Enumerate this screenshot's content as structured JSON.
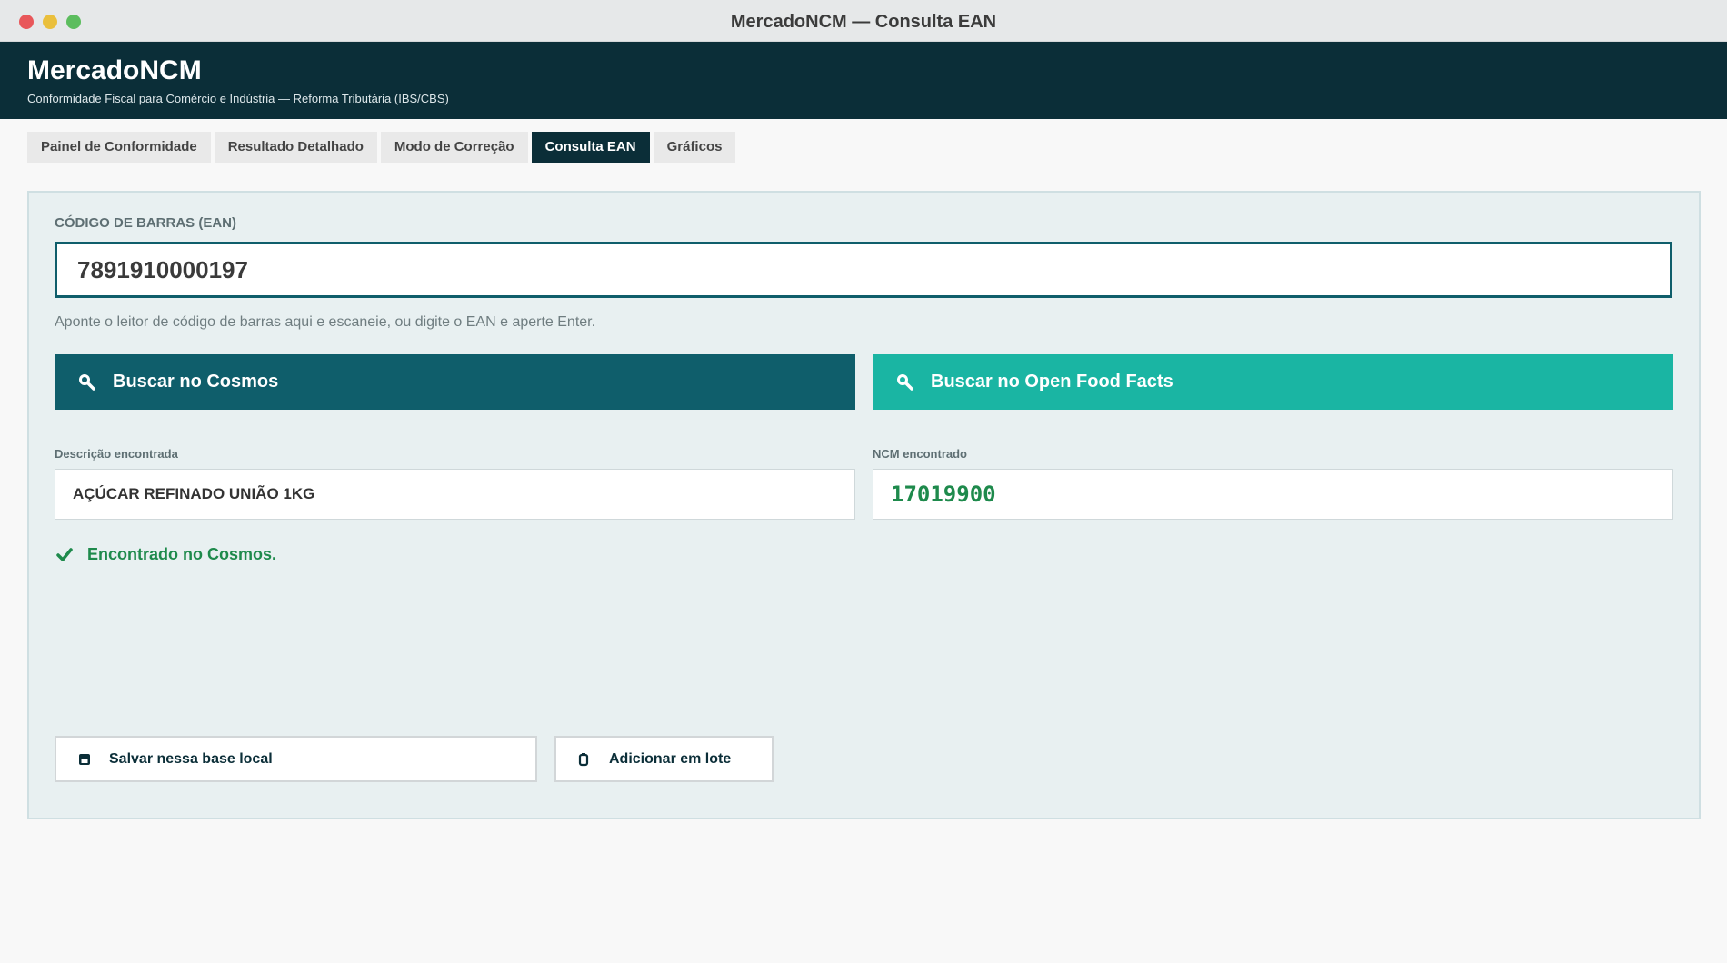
{
  "window": {
    "title": "MercadoNCM — Consulta EAN"
  },
  "header": {
    "brand": "MercadoNCM",
    "tagline": "Conformidade Fiscal para Comércio e Indústria — Reforma Tributária (IBS/CBS)"
  },
  "tabs": [
    {
      "label": "Painel de Conformidade",
      "active": false
    },
    {
      "label": "Resultado Detalhado",
      "active": false
    },
    {
      "label": "Modo de Correção",
      "active": false
    },
    {
      "label": "Consulta EAN",
      "active": true
    },
    {
      "label": "Gráficos",
      "active": false
    }
  ],
  "ean": {
    "label": "CÓDIGO DE BARRAS (EAN)",
    "value": "7891910000197",
    "hint": "Aponte o leitor de código de barras aqui e escaneie, ou digite o EAN e aperte Enter."
  },
  "actions": {
    "cosmos": {
      "label": "Buscar no Cosmos",
      "icon": "search-icon",
      "color": "#0f5e6b"
    },
    "off": {
      "label": "Buscar no Open Food Facts",
      "icon": "search-icon",
      "color": "#1ab5a3"
    }
  },
  "result": {
    "desc_label": "Descrição encontrada",
    "desc_value": "AÇÚCAR REFINADO UNIÃO 1KG",
    "ncm_label": "NCM encontrado",
    "ncm_value": "17019900",
    "status": "Encontrado no Cosmos.",
    "status_icon": "check-icon",
    "status_color": "#1e8a4c"
  },
  "footer_actions": {
    "save": {
      "label": "Salvar nessa base local",
      "icon": "database-icon"
    },
    "batch": {
      "label": "Adicionar em lote",
      "icon": "clipboard-icon"
    }
  }
}
